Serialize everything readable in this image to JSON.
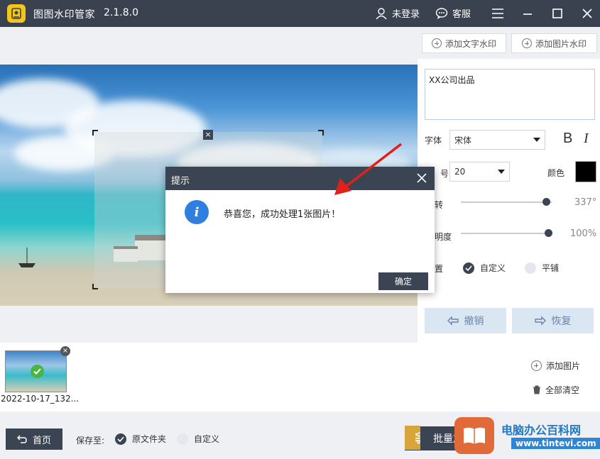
{
  "titlebar": {
    "app_name": "图图水印管家",
    "version": "2.1.8.0",
    "user_label": "未登录",
    "service_label": "客服"
  },
  "toolbar": {
    "add_text_wm": "添加文字水印",
    "add_image_wm": "添加图片水印"
  },
  "settings": {
    "watermark_text": "XX公司出品",
    "font_label": "字体",
    "font_value": "宋体",
    "bold_label": "B",
    "italic_label": "I",
    "size_label": "号",
    "size_value": "20",
    "color_label": "颜色",
    "color_value": "#000000",
    "rotate_label": "转",
    "rotate_value": "337°",
    "rotate_fraction": 0.94,
    "opacity_label": "明度",
    "opacity_value": "100%",
    "opacity_fraction": 1.0,
    "position_label": "置",
    "position_options": [
      "自定义",
      "平铺"
    ],
    "undo_label": "撤销",
    "redo_label": "恢复"
  },
  "dialog": {
    "title": "提示",
    "message": "恭喜您，成功处理1张图片！",
    "ok_label": "确定"
  },
  "images": {
    "thumb_name": "2022-10-17_132...",
    "add_label": "添加图片",
    "clear_label": "全部清空"
  },
  "bottom": {
    "home_label": "首页",
    "save_to_label": "保存至:",
    "save_options": [
      "原文件夹",
      "自定义"
    ],
    "batch_label": "批量加",
    "vip_label": "VIP",
    "watermark_site_1": "电脑办公百科网",
    "watermark_site_2": "www.tintevi.com"
  },
  "colors": {
    "titlebar": "#3a4250",
    "accent": "#3b4452",
    "info": "#2f7fe0",
    "success": "#4bb543"
  }
}
